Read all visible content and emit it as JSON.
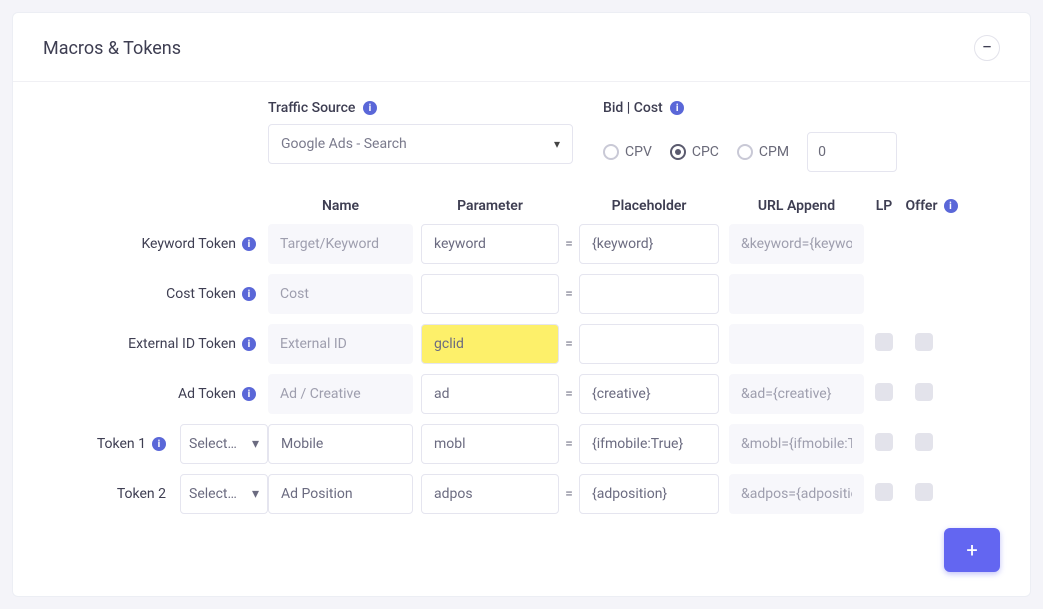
{
  "card": {
    "title": "Macros & Tokens",
    "collapse_glyph": "−"
  },
  "traffic": {
    "label": "Traffic Source",
    "selected": "Google Ads - Search"
  },
  "bidcost": {
    "label": "Bid | Cost",
    "options": {
      "cpv": "CPV",
      "cpc": "CPC",
      "cpm": "CPM"
    },
    "selected": "cpc",
    "value": "0"
  },
  "columns": {
    "name": "Name",
    "parameter": "Parameter",
    "placeholder": "Placeholder",
    "urlappend": "URL Append",
    "lp": "LP",
    "offer": "Offer"
  },
  "rows": [
    {
      "label": "Keyword Token",
      "has_info": true,
      "has_select": false,
      "name": "Target/Keyword",
      "name_readonly": true,
      "param": "keyword",
      "param_highlight": false,
      "placeholder": "{keyword}",
      "append": "&keyword={keyword}",
      "show_checks": false
    },
    {
      "label": "Cost Token",
      "has_info": true,
      "has_select": false,
      "name": "Cost",
      "name_readonly": true,
      "param": "",
      "param_highlight": false,
      "placeholder": "",
      "append": "",
      "show_checks": false
    },
    {
      "label": "External ID Token",
      "has_info": true,
      "has_select": false,
      "name": "External ID",
      "name_readonly": true,
      "param": "gclid",
      "param_highlight": true,
      "placeholder": "",
      "append": "",
      "show_checks": true
    },
    {
      "label": "Ad Token",
      "has_info": true,
      "has_select": false,
      "name": "Ad / Creative",
      "name_readonly": true,
      "param": "ad",
      "param_highlight": false,
      "placeholder": "{creative}",
      "append": "&ad={creative}",
      "show_checks": true
    },
    {
      "label": "Token 1",
      "has_info": true,
      "has_select": true,
      "select_value": "Select…",
      "name": "Mobile",
      "name_readonly": false,
      "param": "mobl",
      "param_highlight": false,
      "placeholder": "{ifmobile:True}",
      "append": "&mobl={ifmobile:True}",
      "show_checks": true
    },
    {
      "label": "Token 2",
      "has_info": false,
      "has_select": true,
      "select_value": "Select…",
      "name": "Ad Position",
      "name_readonly": false,
      "param": "adpos",
      "param_highlight": false,
      "placeholder": "{adposition}",
      "append": "&adpos={adposition}",
      "show_checks": true
    }
  ],
  "add_button": "+",
  "info_glyph": "i"
}
